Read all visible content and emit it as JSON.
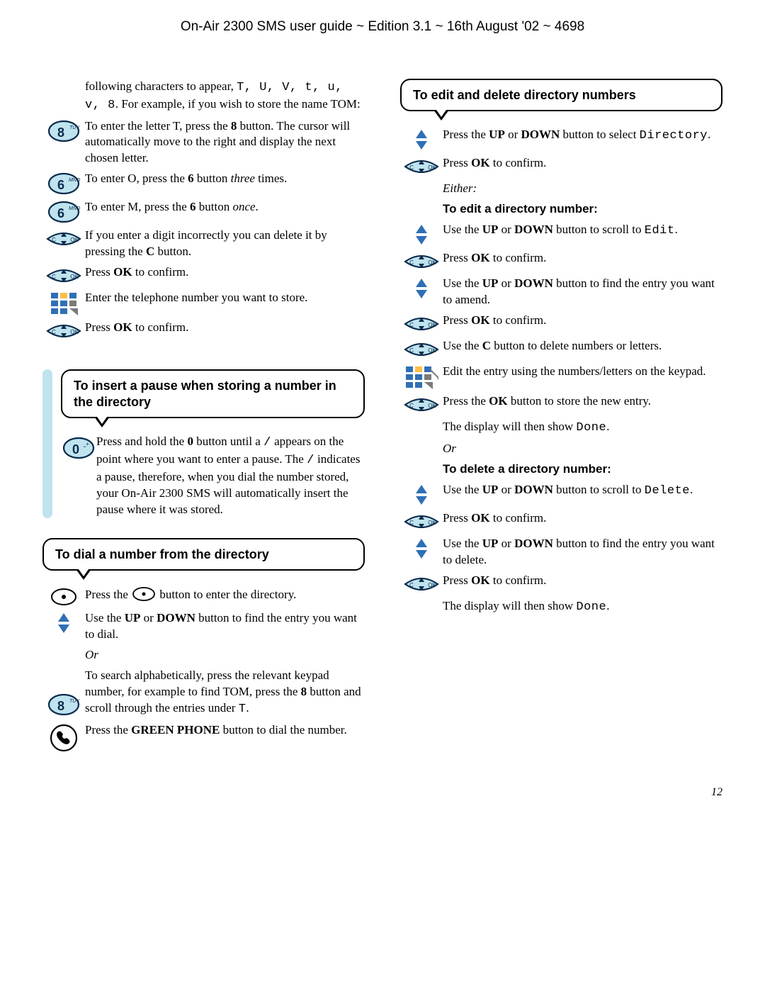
{
  "header": "On-Air 2300 SMS user guide ~ Edition 3.1 ~ 16th August '02 ~ 4698",
  "pagenum": "12",
  "left": {
    "intro_pre": "following characters to appear, ",
    "intro_chars": "T, U, V, t, u, v, 8",
    "intro_post": ". For example, if you wish to store the name TOM:",
    "step8": {
      "pre": "To enter the letter T, press the ",
      "btn": "8",
      "post": " button. The cursor will automatically move to the right and display the next chosen letter."
    },
    "step6a": {
      "pre": "To enter O, press the ",
      "btn": "6",
      "mid": " button ",
      "ital": "three",
      "post": " times."
    },
    "step6b": {
      "pre": "To enter M, press the ",
      "btn": "6",
      "mid": " button ",
      "ital": "once",
      "post": "."
    },
    "stepC": {
      "pre": "If you enter a digit incorrectly you can delete it by pressing the ",
      "btn": "C",
      "post": " button."
    },
    "stepOK1": {
      "pre": "Press ",
      "btn": "OK",
      "post": " to confirm."
    },
    "stepKP": "Enter the telephone number you want to store.",
    "stepOK2": {
      "pre": "Press ",
      "btn": "OK",
      "post": " to confirm."
    },
    "pause": {
      "title": "To insert a pause when storing a number in the directory",
      "step0": {
        "p1a": "Press and hold the ",
        "btn": "0",
        "p1b": " button until a ",
        "slash1": "/",
        "p1c": " appears on the point where you want to enter a pause. The ",
        "slash2": "/",
        "p1d": " indicates a pause, therefore, when you dial the number stored, your On-Air 2300 SMS will automatically insert the pause where it was stored."
      }
    },
    "dial": {
      "title": "To dial a number from the directory",
      "dot": {
        "pre": "Press the ",
        "post": " button to enter the directory."
      },
      "updown": {
        "pre": "Use the ",
        "up": "UP",
        "or": " or ",
        "down": "DOWN",
        "post": " button to find the entry you want to dial."
      },
      "or": "Or",
      "search": {
        "pre": "To search alphabetically, press the relevant keypad number, for example to find TOM, press the ",
        "btn": "8",
        "mid": " button and scroll through the entries under ",
        "t": "T",
        "post": "."
      },
      "green": {
        "pre": "Press the ",
        "btn": "GREEN PHONE",
        "post": " button to dial the number."
      }
    }
  },
  "right": {
    "title": "To edit and delete directory numbers",
    "s1": {
      "pre": "Press the ",
      "up": "UP",
      "or": " or ",
      "down": "DOWN",
      "post": " button to select ",
      "mono": "Directory",
      "end": "."
    },
    "s2": {
      "pre": "Press ",
      "btn": "OK",
      "post": " to confirm."
    },
    "either": "Either:",
    "editHead": "To edit a directory number:",
    "e1": {
      "pre": "Use the ",
      "up": "UP",
      "or": " or ",
      "down": "DOWN",
      "post": " button to scroll to ",
      "mono": "Edit",
      "end": "."
    },
    "e2": {
      "pre": "Press ",
      "btn": "OK",
      "post": " to confirm."
    },
    "e3": {
      "pre": "Use the ",
      "up": "UP",
      "or": " or ",
      "down": "DOWN",
      "post": " button to find the entry you want to amend."
    },
    "e4": {
      "pre": "Press ",
      "btn": "OK",
      "post": " to confirm."
    },
    "e5": {
      "pre": "Use the ",
      "btn": "C",
      "post": " button to delete numbers or letters."
    },
    "e6": "Edit the entry using the numbers/letters on the keypad.",
    "e7": {
      "pre": "Press the ",
      "btn": "OK",
      "post": " button to store the new entry."
    },
    "done1a": "The display will then show ",
    "done1b": "Done",
    "done1c": ".",
    "or": "Or",
    "delHead": "To delete a directory number:",
    "d1": {
      "pre": "Use the ",
      "up": "UP",
      "or": " or ",
      "down": "DOWN",
      "post": " button to scroll to ",
      "mono": "Delete",
      "end": "."
    },
    "d2": {
      "pre": "Press ",
      "btn": "OK",
      "post": " to confirm."
    },
    "d3": {
      "pre": "Use the ",
      "up": "UP",
      "or": " or ",
      "down": "DOWN",
      "post": " button to find the entry you want to delete."
    },
    "d4": {
      "pre": "Press ",
      "btn": "OK",
      "post": " to confirm."
    },
    "done2a": "The display will then show ",
    "done2b": "Done",
    "done2c": "."
  }
}
